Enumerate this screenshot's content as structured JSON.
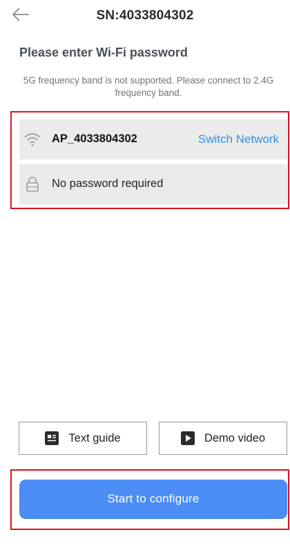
{
  "header": {
    "title": "SN:4033804302",
    "back_icon": "arrow-left-icon"
  },
  "wifi": {
    "section_title": "Please enter Wi-Fi password",
    "hint": "5G frequency band is not supported. Please connect to 2.4G frequency band.",
    "ssid": "AP_4033804302",
    "ssid_icon": "wifi-icon",
    "switch_label": "Switch Network",
    "password_text": "No password required",
    "password_icon": "lock-icon"
  },
  "guides": {
    "text_guide_label": "Text guide",
    "text_guide_icon": "document-icon",
    "demo_video_label": "Demo video",
    "demo_video_icon": "play-icon"
  },
  "actions": {
    "start_label": "Start to configure"
  },
  "colors": {
    "accent": "#4c8cf5",
    "link": "#2f8fe6",
    "highlight": "#e2101b",
    "row_bg": "#ebebeb"
  }
}
